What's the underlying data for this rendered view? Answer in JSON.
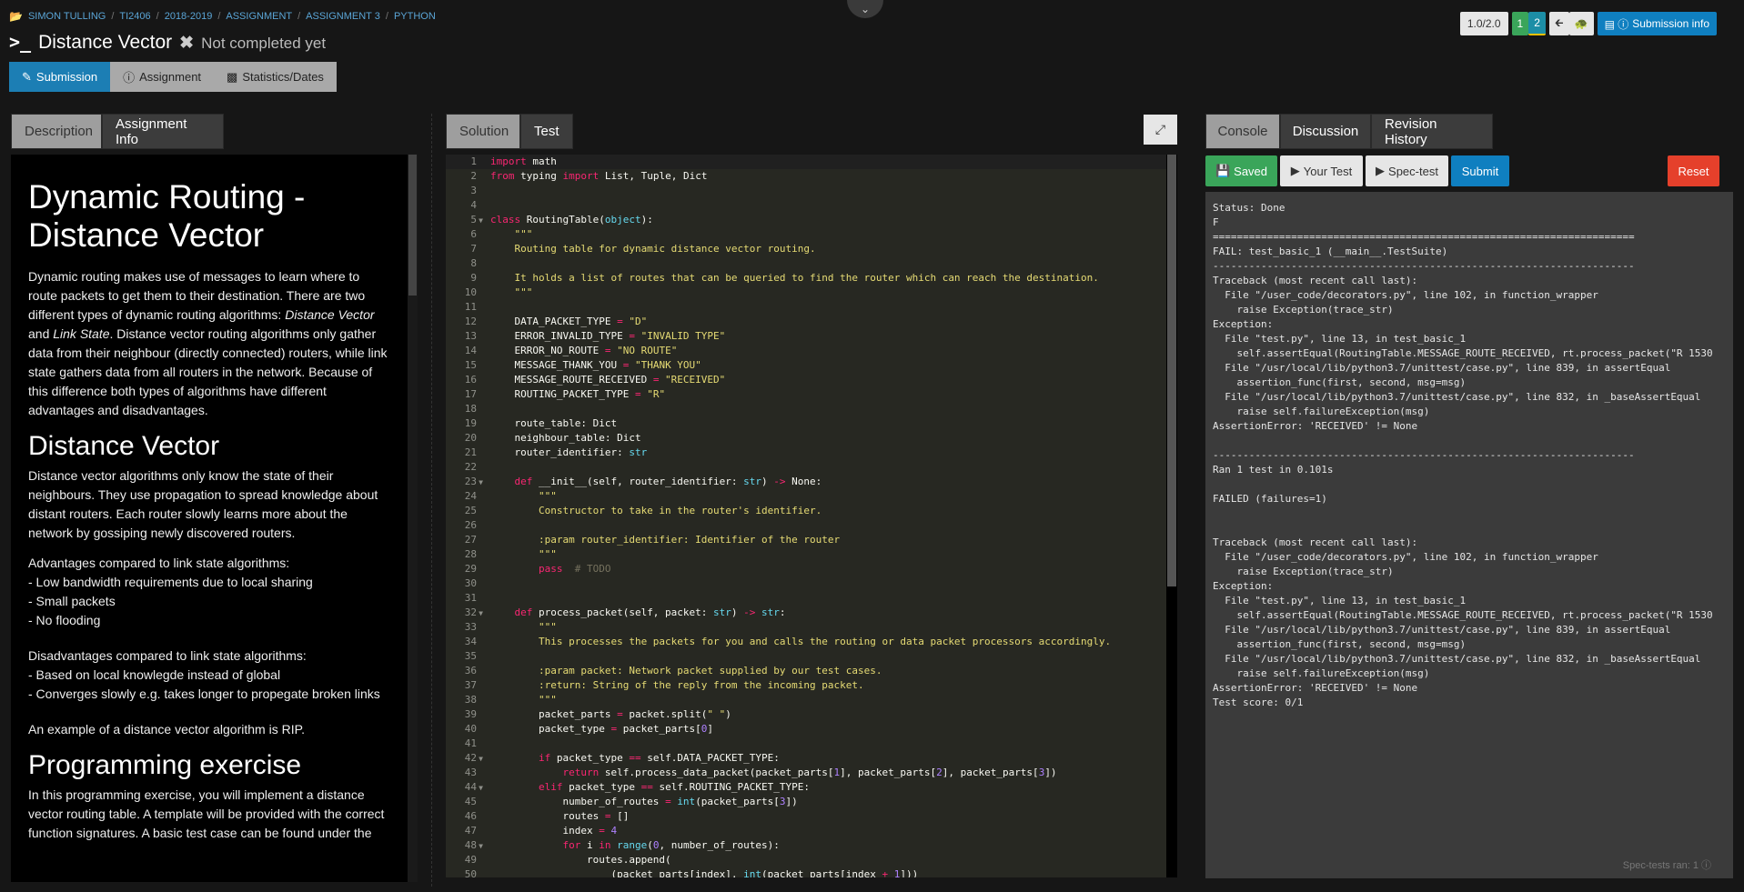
{
  "breadcrumb": [
    "SIMON TULLING",
    "TI2406",
    "2018-2019",
    "ASSIGNMENT",
    "ASSIGNMENT 3",
    "PYTHON"
  ],
  "header": {
    "prompt": ">_",
    "title": "Distance Vector",
    "status": "Not completed yet"
  },
  "top_right": {
    "version": "1.0/2.0",
    "seg1": "1",
    "seg2": "2",
    "submission_info": "Submission info"
  },
  "main_tabs": [
    "Submission",
    "Assignment",
    "Statistics/Dates"
  ],
  "left_tabs": [
    "Description",
    "Assignment Info"
  ],
  "editor_tabs": [
    "Solution",
    "Test"
  ],
  "right_tabs": [
    "Console",
    "Discussion",
    "Revision History"
  ],
  "console_buttons": {
    "saved": "Saved",
    "your_test": "Your Test",
    "spec_test": "Spec-test",
    "submit": "Submit",
    "reset": "Reset"
  },
  "description": {
    "h1": "Dynamic Routing - Distance Vector",
    "p1_a": "Dynamic routing makes use of messages to learn where to route packets to get them to their destination. There are two different types of dynamic routing algorithms: ",
    "p1_em1": "Distance Vector",
    "p1_and": " and ",
    "p1_em2": "Link State",
    "p1_b": ". Distance vector routing algorithms only gather data from their neighbour (directly connected) routers, while link state gathers data from all routers in the network. Because of this difference both types of algorithms have different advantages and disadvantages.",
    "h2_1": "Distance Vector",
    "p2": "Distance vector algorithms only know the state of their neighbours. They use propagation to spread knowledge about distant routers. Each router slowly learns more about the network by gossiping newly discovered routers.",
    "adv_title": "Advantages compared to link state algorithms:",
    "adv": [
      "- Low bandwidth requirements due to local sharing",
      "- Small packets",
      "- No flooding"
    ],
    "dis_title": "Disadvantages compared to link state algorithms:",
    "dis": [
      "- Based on local knowlegde instead of global",
      "- Converges slowly e.g. takes longer to propegate broken links"
    ],
    "p_rip": "An example of a distance vector algorithm is RIP.",
    "h2_2": "Programming exercise",
    "p3": "In this programming exercise, you will implement a distance vector routing table. A template will be provided with the correct function signatures. A basic test case can be found under the"
  },
  "code_lines": [
    "1",
    "2",
    "3",
    "4",
    "5",
    "6",
    "7",
    "8",
    "9",
    "10",
    "11",
    "12",
    "13",
    "14",
    "15",
    "16",
    "17",
    "18",
    "19",
    "20",
    "21",
    "22",
    "23",
    "24",
    "25",
    "26",
    "27",
    "28",
    "29",
    "30",
    "31",
    "32",
    "33",
    "34",
    "35",
    "36",
    "37",
    "38",
    "39",
    "40",
    "41",
    "42",
    "43",
    "44",
    "45",
    "46",
    "47",
    "48",
    "49",
    "50"
  ],
  "code_text": {
    "l1a": "import",
    "l1b": " math",
    "l2a": "from",
    "l2b": " typing ",
    "l2c": "import",
    "l2d": " List, Tuple, Dict",
    "l5a": "class",
    "l5b": " RoutingTable(",
    "l5c": "object",
    "l5d": "):",
    "l6": "    \"\"\"",
    "l7": "    Routing table for dynamic distance vector routing.",
    "l9": "    It holds a list of routes that can be queried to find the router which can reach the destination.",
    "l10": "    \"\"\"",
    "l12a": "    DATA_PACKET_TYPE ",
    "l12b": "=",
    "l12c": " \"D\"",
    "l13a": "    ERROR_INVALID_TYPE ",
    "l13b": "=",
    "l13c": " \"INVALID TYPE\"",
    "l14a": "    ERROR_NO_ROUTE ",
    "l14b": "=",
    "l14c": " \"NO ROUTE\"",
    "l15a": "    MESSAGE_THANK_YOU ",
    "l15b": "=",
    "l15c": " \"THANK YOU\"",
    "l16a": "    MESSAGE_ROUTE_RECEIVED ",
    "l16b": "=",
    "l16c": " \"RECEIVED\"",
    "l17a": "    ROUTING_PACKET_TYPE ",
    "l17b": "=",
    "l17c": " \"R\"",
    "l19": "    route_table: Dict",
    "l20": "    neighbour_table: Dict",
    "l21a": "    router_identifier: ",
    "l21b": "str",
    "l23a": "    def",
    "l23b": " __init__(self, router_identifier: ",
    "l23c": "str",
    "l23d": ") ",
    "l23e": "->",
    "l23f": " None:",
    "l24": "        \"\"\"",
    "l25": "        Constructor to take in the router's identifier.",
    "l27": "        :param router_identifier: Identifier of the router",
    "l28": "        \"\"\"",
    "l29a": "        pass",
    "l29b": "  # TODO",
    "l32a": "    def",
    "l32b": " process_packet(self, packet: ",
    "l32c": "str",
    "l32d": ") ",
    "l32e": "->",
    "l32f": " ",
    "l32g": "str",
    "l32h": ":",
    "l33": "        \"\"\"",
    "l34": "        This processes the packets for you and calls the routing or data packet processors accordingly.",
    "l36": "        :param packet: Network packet supplied by our test cases.",
    "l37": "        :return: String of the reply from the incoming packet.",
    "l38": "        \"\"\"",
    "l39a": "        packet_parts ",
    "l39b": "=",
    "l39c": " packet.split(",
    "l39d": "\" \"",
    "l39e": ")",
    "l40a": "        packet_type ",
    "l40b": "=",
    "l40c": " packet_parts[",
    "l40d": "0",
    "l40e": "]",
    "l42a": "        if",
    "l42b": " packet_type ",
    "l42c": "==",
    "l42d": " self.DATA_PACKET_TYPE:",
    "l43a": "            return",
    "l43b": " self.process_data_packet(packet_parts[",
    "l43c": "1",
    "l43d": "], packet_parts[",
    "l43e": "2",
    "l43f": "], packet_parts[",
    "l43g": "3",
    "l43h": "])",
    "l44a": "        elif",
    "l44b": " packet_type ",
    "l44c": "==",
    "l44d": " self.ROUTING_PACKET_TYPE:",
    "l45a": "            number_of_routes ",
    "l45b": "=",
    "l45c": " ",
    "l45d": "int",
    "l45e": "(packet_parts[",
    "l45f": "3",
    "l45g": "])",
    "l46a": "            routes ",
    "l46b": "=",
    "l46c": " []",
    "l47a": "            index ",
    "l47b": "=",
    "l47c": " ",
    "l47d": "4",
    "l48a": "            for",
    "l48b": " i ",
    "l48c": "in",
    "l48d": " ",
    "l48e": "range",
    "l48f": "(",
    "l48g": "0",
    "l48h": ", number_of_routes):",
    "l49": "                routes.append(",
    "l50a": "                    (packet_parts[index], ",
    "l50b": "int",
    "l50c": "(packet_parts[index ",
    "l50d": "+",
    "l50e": " ",
    "l50f": "1",
    "l50g": "]))"
  },
  "console_output": "Status: Done\nF\n======================================================================\nFAIL: test_basic_1 (__main__.TestSuite)\n----------------------------------------------------------------------\nTraceback (most recent call last):\n  File \"/user_code/decorators.py\", line 102, in function_wrapper\n    raise Exception(trace_str)\nException:\n  File \"test.py\", line 13, in test_basic_1\n    self.assertEqual(RoutingTable.MESSAGE_ROUTE_RECEIVED, rt.process_packet(\"R 1530 \n  File \"/usr/local/lib/python3.7/unittest/case.py\", line 839, in assertEqual\n    assertion_func(first, second, msg=msg)\n  File \"/usr/local/lib/python3.7/unittest/case.py\", line 832, in _baseAssertEqual\n    raise self.failureException(msg)\nAssertionError: 'RECEIVED' != None\n\n----------------------------------------------------------------------\nRan 1 test in 0.101s\n\nFAILED (failures=1)\n\n\nTraceback (most recent call last):\n  File \"/user_code/decorators.py\", line 102, in function_wrapper\n    raise Exception(trace_str)\nException:\n  File \"test.py\", line 13, in test_basic_1\n    self.assertEqual(RoutingTable.MESSAGE_ROUTE_RECEIVED, rt.process_packet(\"R 1530 \n  File \"/usr/local/lib/python3.7/unittest/case.py\", line 839, in assertEqual\n    assertion_func(first, second, msg=msg)\n  File \"/usr/local/lib/python3.7/unittest/case.py\", line 832, in _baseAssertEqual\n    raise self.failureException(msg)\nAssertionError: 'RECEIVED' != None\nTest score: 0/1",
  "spec_tests_ran": "Spec-tests ran: 1",
  "icons": {
    "folder": "folder-icon",
    "collapse": "chevron-down-icon",
    "not_completed": "cross-icon",
    "back": "arrow-left-icon",
    "turtle": "turtle-icon",
    "info": "info-icon",
    "edit": "pencil-icon",
    "chart": "bar-chart-icon",
    "expand": "expand-icon",
    "save": "save-icon",
    "play": "play-icon"
  }
}
